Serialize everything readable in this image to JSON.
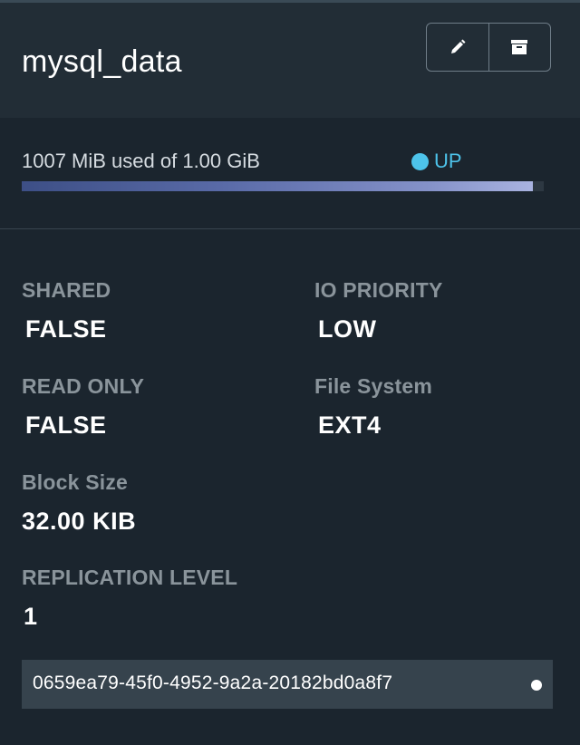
{
  "volume": {
    "title": "mysql_data",
    "usage_text": "1007 MiB used of 1.00 GiB",
    "usage_fraction": 0.98,
    "status": "UP",
    "status_color": "#4dc3ea",
    "id": "0659ea79-45f0-4952-9a2a-20182bd0a8f7"
  },
  "actions": {
    "edit_icon": "pencil-icon",
    "archive_icon": "archive-icon"
  },
  "fields": {
    "shared": {
      "label": "SHARED",
      "value": "FALSE"
    },
    "io_priority": {
      "label": "IO PRIORITY",
      "value": "LOW"
    },
    "read_only": {
      "label": "READ ONLY",
      "value": "FALSE"
    },
    "file_system": {
      "label": "File System",
      "value": "EXT4"
    },
    "block_size": {
      "label": "Block Size",
      "value": "32.00 KIB"
    },
    "replication_level": {
      "label": "REPLICATION LEVEL",
      "value": "1"
    }
  },
  "colors": {
    "background": "#1b252e",
    "header": "#222d36",
    "label": "#8a949b",
    "id_box": "#36434d"
  }
}
